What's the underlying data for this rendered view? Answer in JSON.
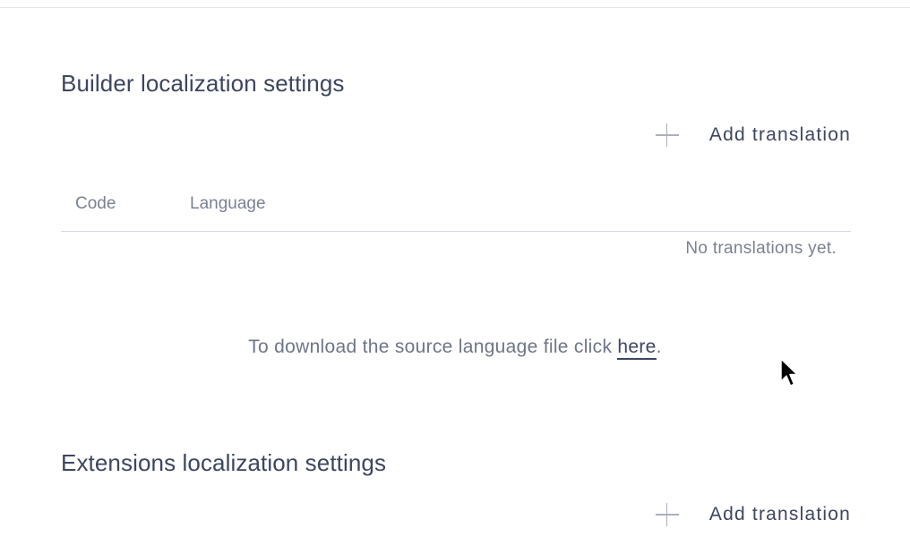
{
  "builder_section": {
    "title": "Builder localization settings",
    "add_button_label": "Add translation",
    "table": {
      "columns": [
        "Code",
        "Language"
      ],
      "empty_message": "No translations yet."
    },
    "download": {
      "prefix": "To download the source language file click ",
      "link_text": "here",
      "suffix": "."
    }
  },
  "extensions_section": {
    "title": "Extensions localization settings",
    "add_button_label": "Add translation"
  },
  "icons": {
    "add": "plus-icon",
    "pointer": "mouse-cursor-icon"
  }
}
